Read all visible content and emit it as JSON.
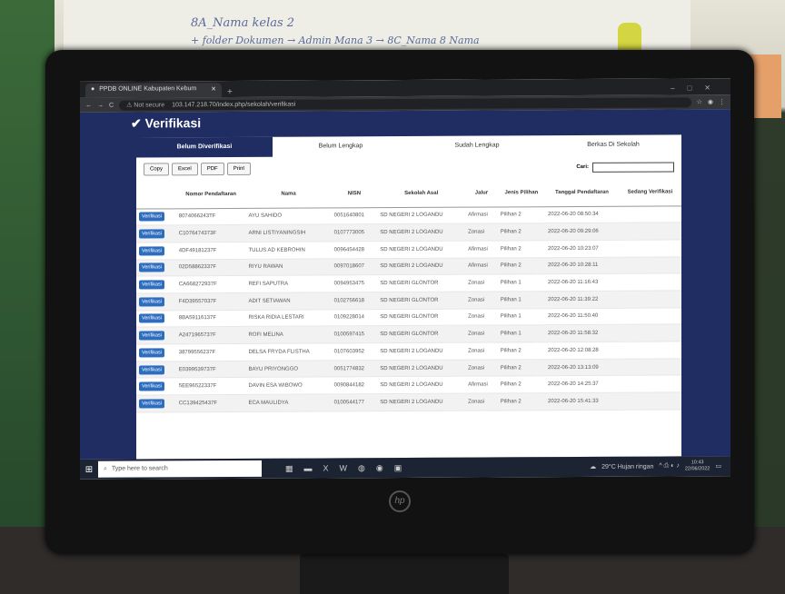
{
  "environment": {
    "handwriting_1": "8A_Nama kelas 2",
    "handwriting_2": "+ folder Dokumen → Admin Mana 3 → 8C_Nama 8 Nama",
    "monitor_brand": "hp"
  },
  "browser": {
    "tab_title": "PPDB ONLINE Kabupaten Kebum",
    "new_tab": "+",
    "not_secure": "Not secure",
    "url": "103.147.218.70/index.php/sekolah/verifikasi"
  },
  "page": {
    "title": "Verifikasi",
    "tabs": [
      "Belum Diverifikasi",
      "Belum Lengkap",
      "Sudah Lengkap",
      "Berkas Di Sekolah"
    ],
    "buttons": [
      "Copy",
      "Excel",
      "PDF",
      "Print"
    ],
    "search_label": "Cari:",
    "columns": [
      "",
      "Nomor Pendaftaran",
      "Nama",
      "NISN",
      "Sekolah Asal",
      "Jalur",
      "Jenis Pilihan",
      "Tanggal Pendaftaran",
      "Sedang Verifikasi"
    ],
    "rows": [
      {
        "btn": "Verifikasi",
        "no": "8074066243TF",
        "nama": "AYU SAHIDO",
        "nisn": "0051640801",
        "asal": "SD NEGERI 2 LOGANDU",
        "jalur": "Afirmasi",
        "pilihan": "Pilihan 2",
        "tgl": "2022-06-20 08:50:34"
      },
      {
        "btn": "Verifikasi",
        "no": "C1076474373F",
        "nama": "ARNI LISTIYANINGSIH",
        "nisn": "0107773005",
        "asal": "SD NEGERI 2 LOGANDU",
        "jalur": "Zonasi",
        "pilihan": "Pilihan 2",
        "tgl": "2022-06-20 09:29:06"
      },
      {
        "btn": "Verifikasi",
        "no": "4DF49181237F",
        "nama": "TULUS AD KEBROHIN",
        "nisn": "0096454428",
        "asal": "SD NEGERI 2 LOGANDU",
        "jalur": "Afirmasi",
        "pilihan": "Pilihan 2",
        "tgl": "2022-06-20 10:23:07"
      },
      {
        "btn": "Verifikasi",
        "no": "02D58862337F",
        "nama": "RIYU RAWAN",
        "nisn": "0097018607",
        "asal": "SD NEGERI 2 LOGANDU",
        "jalur": "Afirmasi",
        "pilihan": "Pilihan 2",
        "tgl": "2022-06-20 10:28:11"
      },
      {
        "btn": "Verifikasi",
        "no": "CA668272937F",
        "nama": "REFI SAPUTRA",
        "nisn": "0094953475",
        "asal": "SD NEGERI GLONTOR",
        "jalur": "Zonasi",
        "pilihan": "Pilihan 1",
        "tgl": "2022-06-20 11:16:43"
      },
      {
        "btn": "Verifikasi",
        "no": "F4D39557037F",
        "nama": "ADIT SETIAWAN",
        "nisn": "0102756618",
        "asal": "SD NEGERI GLONTOR",
        "jalur": "Zonasi",
        "pilihan": "Pilihan 1",
        "tgl": "2022-06-20 11:39:22"
      },
      {
        "btn": "Verifikasi",
        "no": "8BA59116137F",
        "nama": "RISKA RIDIA LESTARI",
        "nisn": "0109228014",
        "asal": "SD NEGERI GLONTOR",
        "jalur": "Zonasi",
        "pilihan": "Pilihan 1",
        "tgl": "2022-06-20 11:50:40"
      },
      {
        "btn": "Verifikasi",
        "no": "A2471965737F",
        "nama": "ROFI MELINA",
        "nisn": "0100597415",
        "asal": "SD NEGERI GLONTOR",
        "jalur": "Zonasi",
        "pilihan": "Pilihan 1",
        "tgl": "2022-06-20 11:58:32"
      },
      {
        "btn": "Verifikasi",
        "no": "38799556237F",
        "nama": "DELSA FRYDA FLISTHA",
        "nisn": "0107603952",
        "asal": "SD NEGERI 2 LOGANDU",
        "jalur": "Zonasi",
        "pilihan": "Pilihan 2",
        "tgl": "2022-06-20 12:08:28"
      },
      {
        "btn": "Verifikasi",
        "no": "E0399539737F",
        "nama": "BAYU PRIYONGGO",
        "nisn": "0051774832",
        "asal": "SD NEGERI 2 LOGANDU",
        "jalur": "Zonasi",
        "pilihan": "Pilihan 2",
        "tgl": "2022-06-20 13:13:09"
      },
      {
        "btn": "Verifikasi",
        "no": "5EE96522337F",
        "nama": "DAVIN ESA WIBOWO",
        "nisn": "0090844182",
        "asal": "SD NEGERI 2 LOGANDU",
        "jalur": "Afirmasi",
        "pilihan": "Pilihan 2",
        "tgl": "2022-06-20 14:25:37"
      },
      {
        "btn": "Verifikasi",
        "no": "CC139425437F",
        "nama": "ECA MAULIDYA",
        "nisn": "0100544177",
        "asal": "SD NEGERI 2 LOGANDU",
        "jalur": "Zonasi",
        "pilihan": "Pilihan 2",
        "tgl": "2022-06-20 15:41:33"
      }
    ]
  },
  "taskbar": {
    "search_placeholder": "Type here to search",
    "weather": "29°C Hujan ringan",
    "time": "10:43",
    "date": "22/06/2022"
  }
}
